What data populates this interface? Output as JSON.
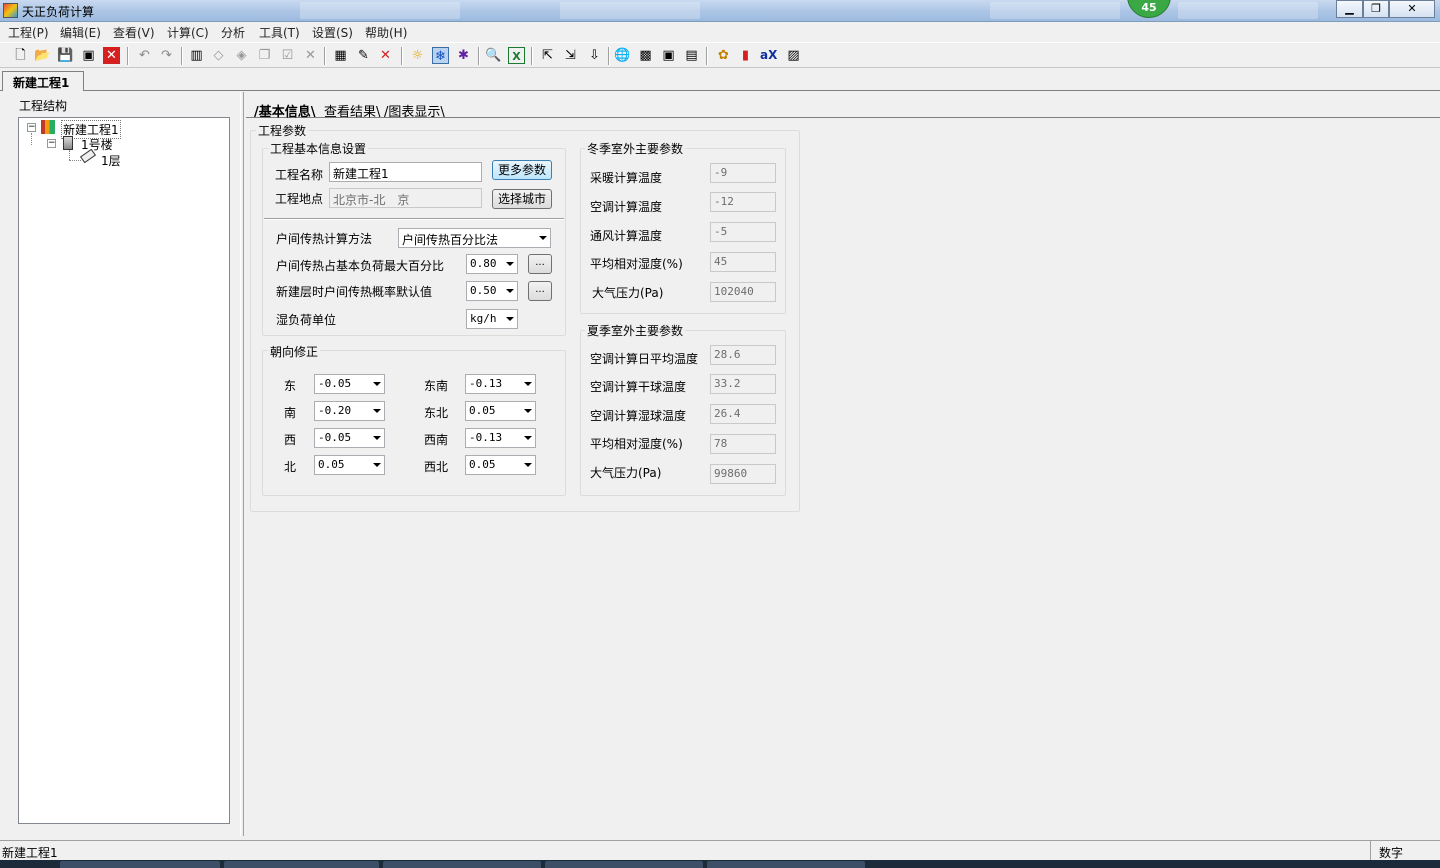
{
  "window": {
    "title": "天正负荷计算",
    "badge": "45"
  },
  "menu": [
    "工程(P)",
    "编辑(E)",
    "查看(V)",
    "计算(C)",
    "分析",
    "工具(T)",
    "设置(S)",
    "帮助(H)"
  ],
  "toolbar_icons": [
    "new-icon",
    "open-icon",
    "save-icon",
    "save-all-icon",
    "close-icon",
    "undo-icon",
    "redo-icon",
    "building-icon",
    "floor-icon",
    "room-icon",
    "copy-icon",
    "check-icon",
    "delete-icon",
    "library-icon",
    "edit-icon",
    "red-x-icon",
    "sun-icon",
    "snow-icon",
    "cold-icon",
    "search-doc-icon",
    "excel-icon",
    "export-icon",
    "import-icon",
    "import2-icon",
    "globe-icon",
    "grid-icon",
    "window-icon",
    "doc-icon",
    "sunflower-icon",
    "bar-chart-icon",
    "ax-icon",
    "hatch-icon"
  ],
  "doc_tab": "新建工程1",
  "left": {
    "label": "工程结构",
    "tree": {
      "root": "新建工程1",
      "building": "1号楼",
      "floor": "1层"
    }
  },
  "tabs": [
    "基本信息",
    "查看结果",
    "图表显示"
  ],
  "project_params": {
    "title": "工程参数",
    "basic": {
      "title": "工程基本信息设置",
      "name_label": "工程名称",
      "name_value": "新建工程1",
      "more_btn": "更多参数",
      "location_label": "工程地点",
      "location_value": "北京市-北　京",
      "city_btn": "选择城市"
    },
    "heat": {
      "method_label": "户间传热计算方法",
      "method_value": "户间传热百分比法",
      "max_pct_label": "户间传热占基本负荷最大百分比",
      "max_pct_value": "0.80",
      "prob_label": "新建层时户间传热概率默认值",
      "prob_value": "0.50",
      "dots": "...",
      "humid_label": "湿负荷单位",
      "humid_value": "kg/h"
    },
    "orient": {
      "title": "朝向修正",
      "items": [
        {
          "label": "东",
          "value": "-0.05"
        },
        {
          "label": "东南",
          "value": "-0.13"
        },
        {
          "label": "南",
          "value": "-0.20"
        },
        {
          "label": "东北",
          "value": "0.05"
        },
        {
          "label": "西",
          "value": "-0.05"
        },
        {
          "label": "西南",
          "value": "-0.13"
        },
        {
          "label": "北",
          "value": "0.05"
        },
        {
          "label": "西北",
          "value": "0.05"
        }
      ]
    }
  },
  "winter": {
    "title": "冬季室外主要参数",
    "items": [
      {
        "label": "采暖计算温度",
        "value": "-9"
      },
      {
        "label": "空调计算温度",
        "value": "-12"
      },
      {
        "label": "通风计算温度",
        "value": "-5"
      },
      {
        "label": "平均相对湿度(%)",
        "value": "45"
      },
      {
        "label": "大气压力(Pa)",
        "value": "102040"
      }
    ]
  },
  "summer": {
    "title": "夏季室外主要参数",
    "items": [
      {
        "label": "空调计算日平均温度",
        "value": "28.6"
      },
      {
        "label": "空调计算干球温度",
        "value": "33.2"
      },
      {
        "label": "空调计算湿球温度",
        "value": "26.4"
      },
      {
        "label": "平均相对湿度(%)",
        "value": "78"
      },
      {
        "label": "大气压力(Pa)",
        "value": "99860"
      }
    ]
  },
  "status": {
    "left": "新建工程1",
    "right": "数字"
  }
}
